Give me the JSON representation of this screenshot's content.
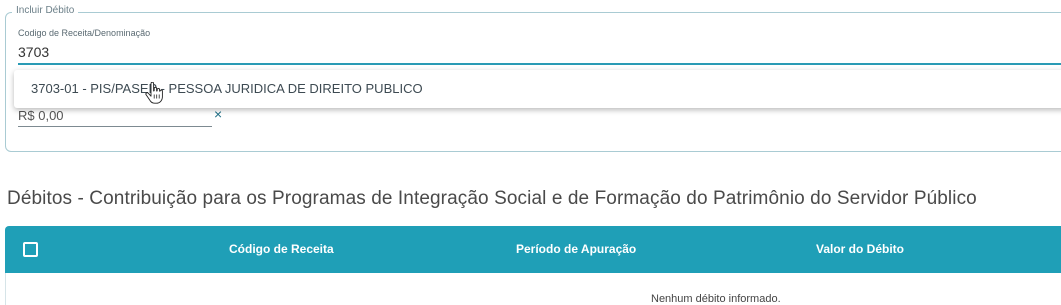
{
  "form": {
    "legend": "Incluir Débito",
    "receita_label": "Codigo de Receita/Denominação",
    "receita_value": "3703",
    "suggestion": "3703-01 - PIS/PASEP - PESSOA JURIDICA DE DIREITO PUBLICO",
    "amount_value": "R$ 0,00",
    "clear_symbol": "×"
  },
  "section": {
    "title": "Débitos - Contribuição para os Programas de Integração Social e de Formação do Patrimônio do Servidor Público"
  },
  "table": {
    "columns": [
      "Código de Receita",
      "Período de Apuração",
      "Valor do Débito"
    ],
    "empty_message": "Nenhum débito informado."
  },
  "colors": {
    "accent": "#1f9fb7",
    "underline_active": "#2a9bb5",
    "border": "#a9cbd3"
  },
  "icons": {
    "cursor": "hand-pointer-icon",
    "clear": "close-icon",
    "checkbox": "checkbox-icon"
  }
}
